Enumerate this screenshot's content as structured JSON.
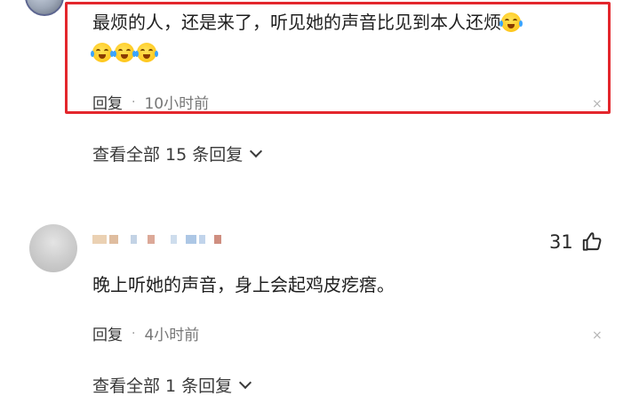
{
  "comment1": {
    "text_line1": "最烦的人，还是来了，听见她的声音比见到本人还烦",
    "reply_label": "回复",
    "separator": "·",
    "time": "10小时前",
    "close_glyph": "×",
    "emoji_icon": "crying-laughing-face-icon"
  },
  "view_all_1": {
    "label": "查看全部 15 条回复"
  },
  "comment2": {
    "like_count": "31",
    "text": "晚上听她的声音，身上会起鸡皮疙瘩。",
    "reply_label": "回复",
    "separator": "·",
    "time": "4小时前",
    "close_glyph": "×"
  },
  "view_all_2": {
    "label": "查看全部 1 条回复"
  },
  "colors": {
    "highlight_border": "#e3262c",
    "text": "#1f1f1f",
    "muted": "#777777"
  }
}
